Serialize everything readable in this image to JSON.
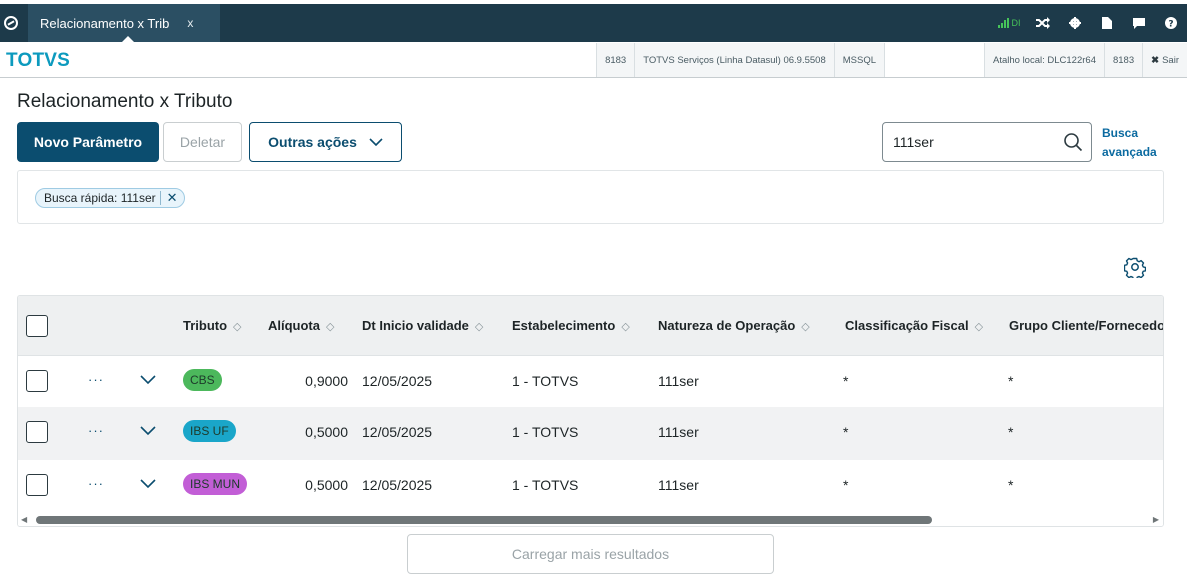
{
  "topbar": {
    "tab_label": "Relacionamento x Trib",
    "tab_close": "x",
    "signal_text": "DI",
    "icons": [
      "shuffle-icon",
      "gear-icon",
      "document-icon",
      "chat-icon",
      "help-icon"
    ]
  },
  "infobar": {
    "brand": "TOTVS",
    "company_code": "8183",
    "product": "TOTVS Serviços (Linha Datasul) 06.9.5508",
    "database": "MSSQL",
    "shortcut": "Atalho local: DLC122r64",
    "user_code": "8183",
    "exit_label": "Sair"
  },
  "page": {
    "title": "Relacionamento x Tributo"
  },
  "actions": {
    "new_label": "Novo Parâmetro",
    "delete_label": "Deletar",
    "more_label": "Outras ações"
  },
  "search": {
    "value": "111ser",
    "advanced_line1": "Busca",
    "advanced_line2": "avançada"
  },
  "filter": {
    "chip_label": "Busca rápida: 111ser"
  },
  "table": {
    "columns": [
      "Tributo",
      "Alíquota",
      "Dt Inicio validade",
      "Estabelecimento",
      "Natureza de Operação",
      "Classificação Fiscal",
      "Grupo Cliente/Fornecedor"
    ],
    "rows": [
      {
        "tributo": "CBS",
        "aliquota": "0,9000",
        "dt_inicio": "12/05/2025",
        "estabelecimento": "1 - TOTVS",
        "natureza": "111ser",
        "classificacao": "*",
        "grupo": "*"
      },
      {
        "tributo": "IBS UF",
        "aliquota": "0,5000",
        "dt_inicio": "12/05/2025",
        "estabelecimento": "1 - TOTVS",
        "natureza": "111ser",
        "classificacao": "*",
        "grupo": "*"
      },
      {
        "tributo": "IBS MUN",
        "aliquota": "0,5000",
        "dt_inicio": "12/05/2025",
        "estabelecimento": "1 - TOTVS",
        "natureza": "111ser",
        "classificacao": "*",
        "grupo": "*"
      }
    ],
    "row_actions": "···"
  },
  "tag_colors": {
    "CBS": "#4cb85c",
    "IBS UF": "#1aa6c9",
    "IBS MUN": "#c25ed6"
  },
  "footer": {
    "load_more_label": "Carregar mais resultados"
  }
}
